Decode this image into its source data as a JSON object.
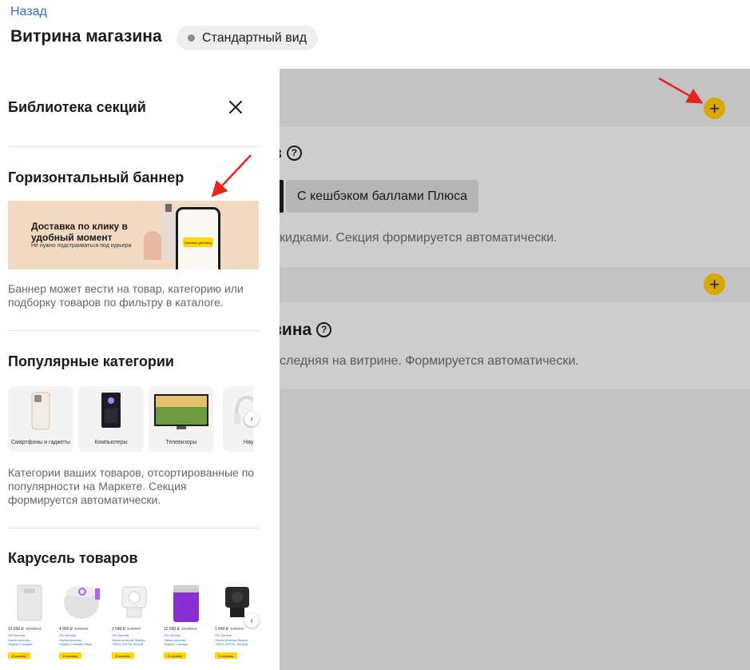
{
  "header": {
    "back_link": "Назад",
    "title": "Витрина магазина",
    "view_chip": "Стандартный вид"
  },
  "background": {
    "section_1_title_fragment": "в",
    "section_1_tab_label": "С кешбэком баллами Плюса",
    "section_1_desc_fragment": "кидками. Секция формируется автоматически.",
    "section_2_title_fragment": "вина",
    "section_2_desc_fragment": "следняя на витрине. Формируется автоматически.",
    "add_button_icon": "plus-icon"
  },
  "panel": {
    "title": "Библиотека секций",
    "horizontal_banner": {
      "title": "Горизонтальный баннер",
      "banner_headline": "Доставка по клику в удобный момент",
      "banner_subline": "Не нужно подстраиваться под курьера",
      "banner_button": "Заказать доставку",
      "description": "Баннер может вести на товар, категорию или подборку товаров по фильтру в каталоге."
    },
    "popular_categories": {
      "title": "Популярные категории",
      "items": [
        {
          "label": "Смартфоны и гаджеты"
        },
        {
          "label": "Компьютеры"
        },
        {
          "label": "Телевизоры"
        },
        {
          "label": "Нау"
        }
      ],
      "description": "Категории ваших товаров, отсортированные по популярности на Маркете. Секция формируется автоматически."
    },
    "product_carousel": {
      "title": "Карусель товаров",
      "items": [
        {
          "price": "12 650 ₽",
          "old_price": "13 650 ₽",
          "cashback": "250 баллов",
          "name": "Умная колонка Яндекс.Станция",
          "buy": "В корзину"
        },
        {
          "price": "4 990 ₽",
          "old_price": "5 990 ₽",
          "cashback": "250 баллов",
          "name": "Умная колонка Яндекс.Станция Мини",
          "buy": "В корзину"
        },
        {
          "price": "1 040 ₽",
          "old_price": "1 990 ₽",
          "cashback": "250 баллов",
          "name": "Умная розетка Яндекс YNDX-0007W, белый",
          "buy": "В корзину"
        },
        {
          "price": "12 650 ₽",
          "old_price": "13 650 ₽",
          "cashback": "250 баллов",
          "name": "Умная колонка Яндекс.Станция",
          "buy": "В корзину"
        },
        {
          "price": "1 040 ₽",
          "old_price": "1 990 ₽",
          "cashback": "250 баллов",
          "name": "Умная розетка Яндекс YNDX-0007W, черный",
          "buy": "В корзину"
        }
      ]
    }
  },
  "colors": {
    "accent": "#d9a800",
    "link": "#2c6fc6",
    "annotation_arrow": "#e8231e",
    "overlay": "#c3c3c3"
  }
}
